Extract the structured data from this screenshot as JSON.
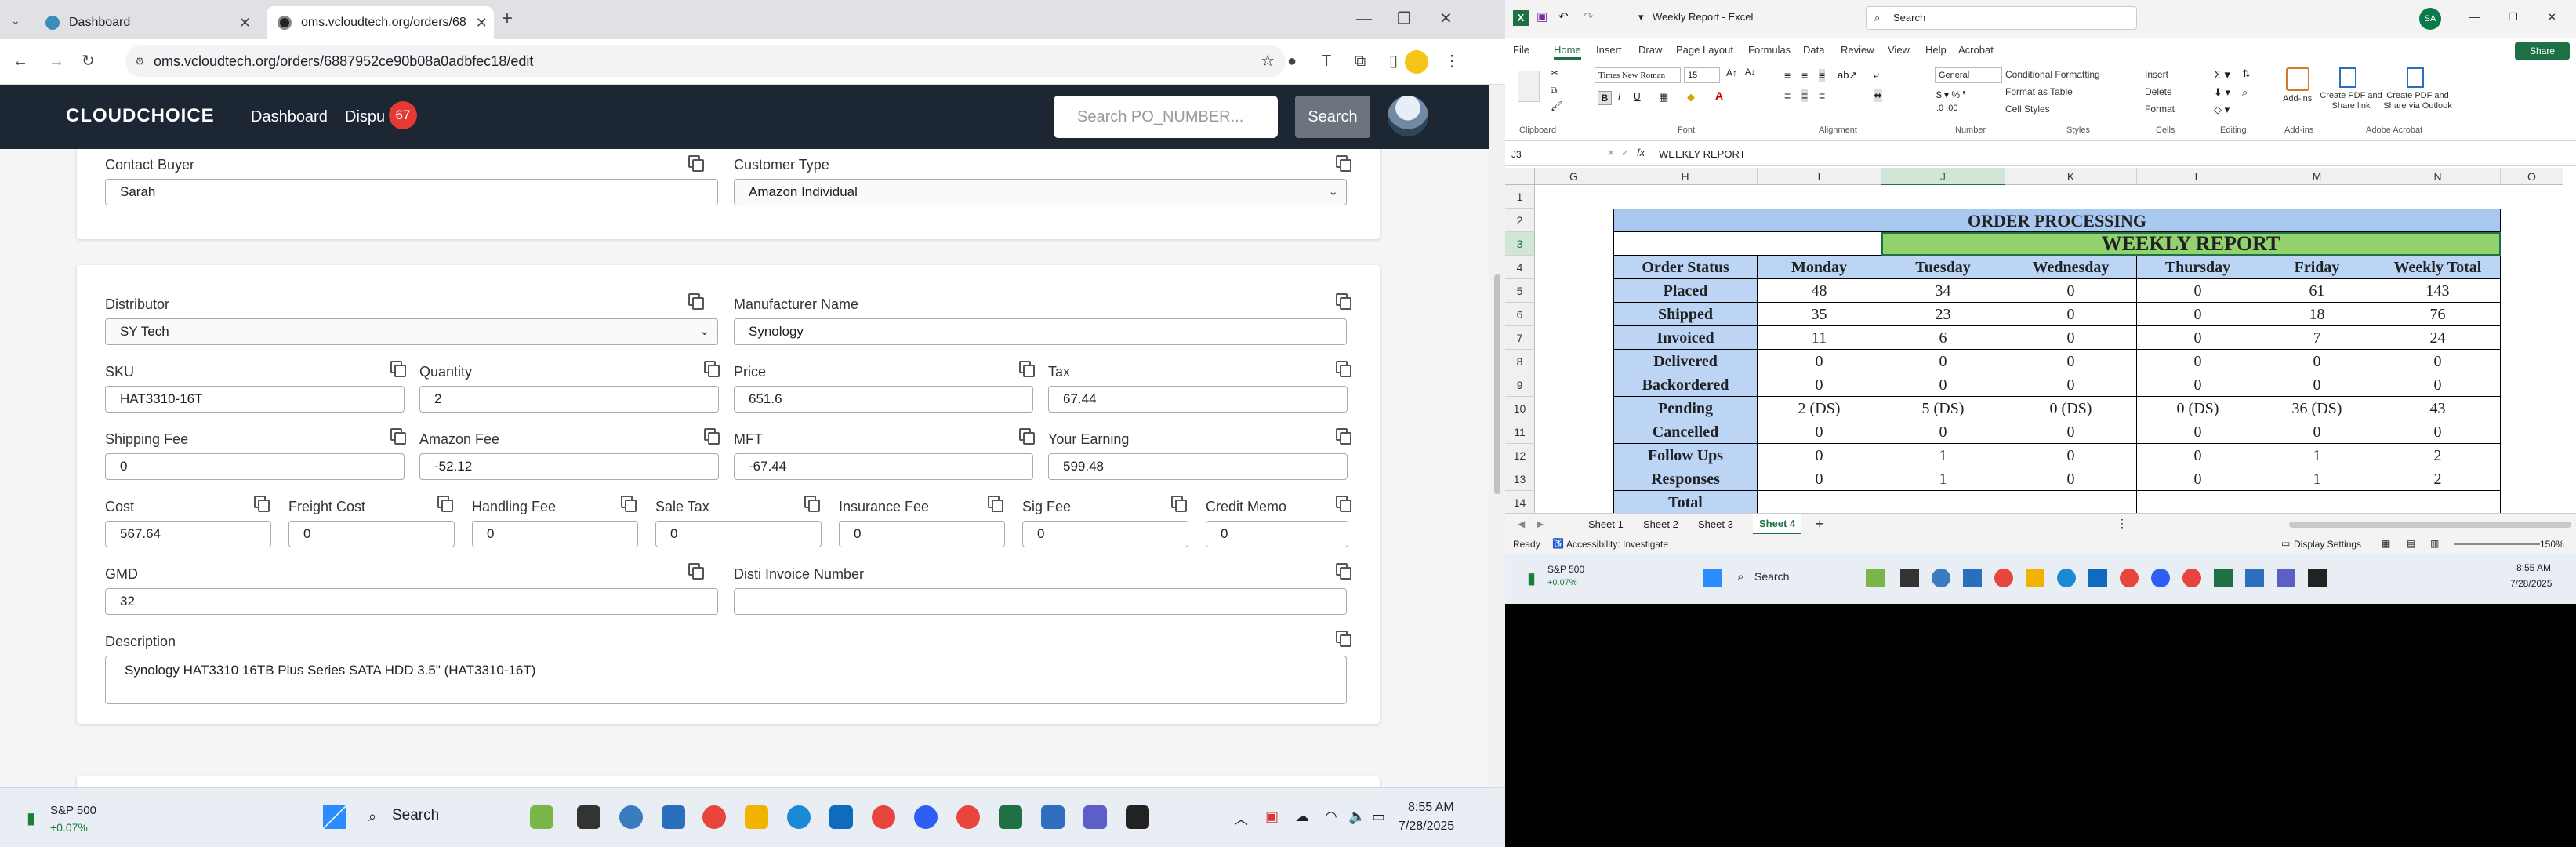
{
  "browser": {
    "tabs": [
      {
        "label": "Dashboard",
        "active": false
      },
      {
        "label": "oms.vcloudtech.org/orders/68",
        "active": true
      }
    ],
    "url": "oms.vcloudtech.org/orders/6887952ce90b08a0adbfec18/edit"
  },
  "app": {
    "logo": "CLOUDCHOICE",
    "nav": {
      "dashboard": "Dashboard",
      "disputes": "Dispu",
      "disputes_badge": "67"
    },
    "search_placeholder": "Search PO_NUMBER...",
    "search_button": "Search"
  },
  "form": {
    "contact_buyer": {
      "label": "Contact Buyer",
      "value": "Sarah"
    },
    "customer_type": {
      "label": "Customer Type",
      "value": "Amazon Individual"
    },
    "distributor": {
      "label": "Distributor",
      "value": "SY Tech"
    },
    "manufacturer": {
      "label": "Manufacturer Name",
      "value": "Synology"
    },
    "sku": {
      "label": "SKU",
      "value": "HAT3310-16T"
    },
    "quantity": {
      "label": "Quantity",
      "value": "2"
    },
    "price": {
      "label": "Price",
      "value": "651.6"
    },
    "tax": {
      "label": "Tax",
      "value": "67.44"
    },
    "shipping_fee": {
      "label": "Shipping Fee",
      "value": "0"
    },
    "amazon_fee": {
      "label": "Amazon Fee",
      "value": "-52.12"
    },
    "mft": {
      "label": "MFT",
      "value": "-67.44"
    },
    "your_earning": {
      "label": "Your Earning",
      "value": "599.48"
    },
    "cost": {
      "label": "Cost",
      "value": "567.64"
    },
    "freight_cost": {
      "label": "Freight Cost",
      "value": "0"
    },
    "handling_fee": {
      "label": "Handling Fee",
      "value": "0"
    },
    "sale_tax": {
      "label": "Sale Tax",
      "value": "0"
    },
    "insurance_fee": {
      "label": "Insurance Fee",
      "value": "0"
    },
    "sig_fee": {
      "label": "Sig Fee",
      "value": "0"
    },
    "credit_memo": {
      "label": "Credit Memo",
      "value": "0"
    },
    "gmd": {
      "label": "GMD",
      "value": "32"
    },
    "disti_invoice": {
      "label": "Disti Invoice Number",
      "value": ""
    },
    "description": {
      "label": "Description",
      "value": "Synology HAT3310 16TB Plus Series SATA HDD 3.5\" (HAT3310-16T)"
    }
  },
  "taskbar_left": {
    "widget_name": "S&P 500",
    "widget_change": "+0.07%",
    "search": "Search",
    "time": "8:55 AM",
    "date": "7/28/2025"
  },
  "excel": {
    "title": "Weekly Report - Excel",
    "search": "Search",
    "user_initials": "SA",
    "share": "Share",
    "ribbon_tabs": [
      "File",
      "Home",
      "Insert",
      "Draw",
      "Page Layout",
      "Formulas",
      "Data",
      "Review",
      "View",
      "Help",
      "Acrobat"
    ],
    "font_name": "Times New Roman",
    "font_size": "15",
    "number_format": "General",
    "styles": [
      "Conditional Formatting",
      "Format as Table",
      "Cell Styles"
    ],
    "cells_group": [
      "Insert",
      "Delete",
      "Format"
    ],
    "group_labels": [
      "Clipboard",
      "Font",
      "Alignment",
      "Number",
      "Styles",
      "Cells",
      "Editing",
      "Add-ins",
      "Adobe Acrobat"
    ],
    "addins": [
      "Add-ins",
      "Create PDF and Share link",
      "Create PDF and Share via Outlook"
    ],
    "name_box": "J3",
    "formula": "WEEKLY REPORT",
    "columns": [
      "G",
      "H",
      "I",
      "J",
      "K",
      "L",
      "M",
      "N",
      "O"
    ],
    "rows": [
      "1",
      "2",
      "3",
      "4",
      "5",
      "6",
      "7",
      "8",
      "9",
      "10",
      "11",
      "12",
      "13",
      "14"
    ],
    "header_title": "ORDER PROCESSING",
    "sub_title": "WEEKLY REPORT",
    "table_header": [
      "Order Status",
      "Monday",
      "Tuesday",
      "Wednesday",
      "Thursday",
      "Friday",
      "Weekly Total"
    ],
    "table_rows": [
      [
        "Placed",
        "48",
        "34",
        "0",
        "0",
        "61",
        "143"
      ],
      [
        "Shipped",
        "35",
        "23",
        "0",
        "0",
        "18",
        "76"
      ],
      [
        "Invoiced",
        "11",
        "6",
        "0",
        "0",
        "7",
        "24"
      ],
      [
        "Delivered",
        "0",
        "0",
        "0",
        "0",
        "0",
        "0"
      ],
      [
        "Backordered",
        "0",
        "0",
        "0",
        "0",
        "0",
        "0"
      ],
      [
        "Pending",
        "2 (DS)",
        "5 (DS)",
        "0 (DS)",
        "0 (DS)",
        "36 (DS)",
        "43"
      ],
      [
        "Cancelled",
        "0",
        "0",
        "0",
        "0",
        "0",
        "0"
      ],
      [
        "Follow Ups",
        "0",
        "1",
        "0",
        "0",
        "1",
        "2"
      ],
      [
        "Responses",
        "0",
        "1",
        "0",
        "0",
        "1",
        "2"
      ],
      [
        "Total",
        "",
        "",
        "",
        "",
        "",
        ""
      ]
    ],
    "sheets": [
      "Sheet 1",
      "Sheet 2",
      "Sheet 3",
      "Sheet 4"
    ],
    "active_sheet": "Sheet 4",
    "status_ready": "Ready",
    "accessibility": "Accessibility: Investigate",
    "display_settings": "Display Settings",
    "zoom": "150%",
    "colors": {
      "title_fill": "#a8c8f0",
      "subtitle_fill": "#92d36e",
      "header_fill": "#bcd5f5"
    }
  },
  "taskbar_right": {
    "widget_name": "S&P 500",
    "widget_change": "+0.07%",
    "search": "Search",
    "time": "8:55 AM",
    "date": "7/28/2025"
  }
}
